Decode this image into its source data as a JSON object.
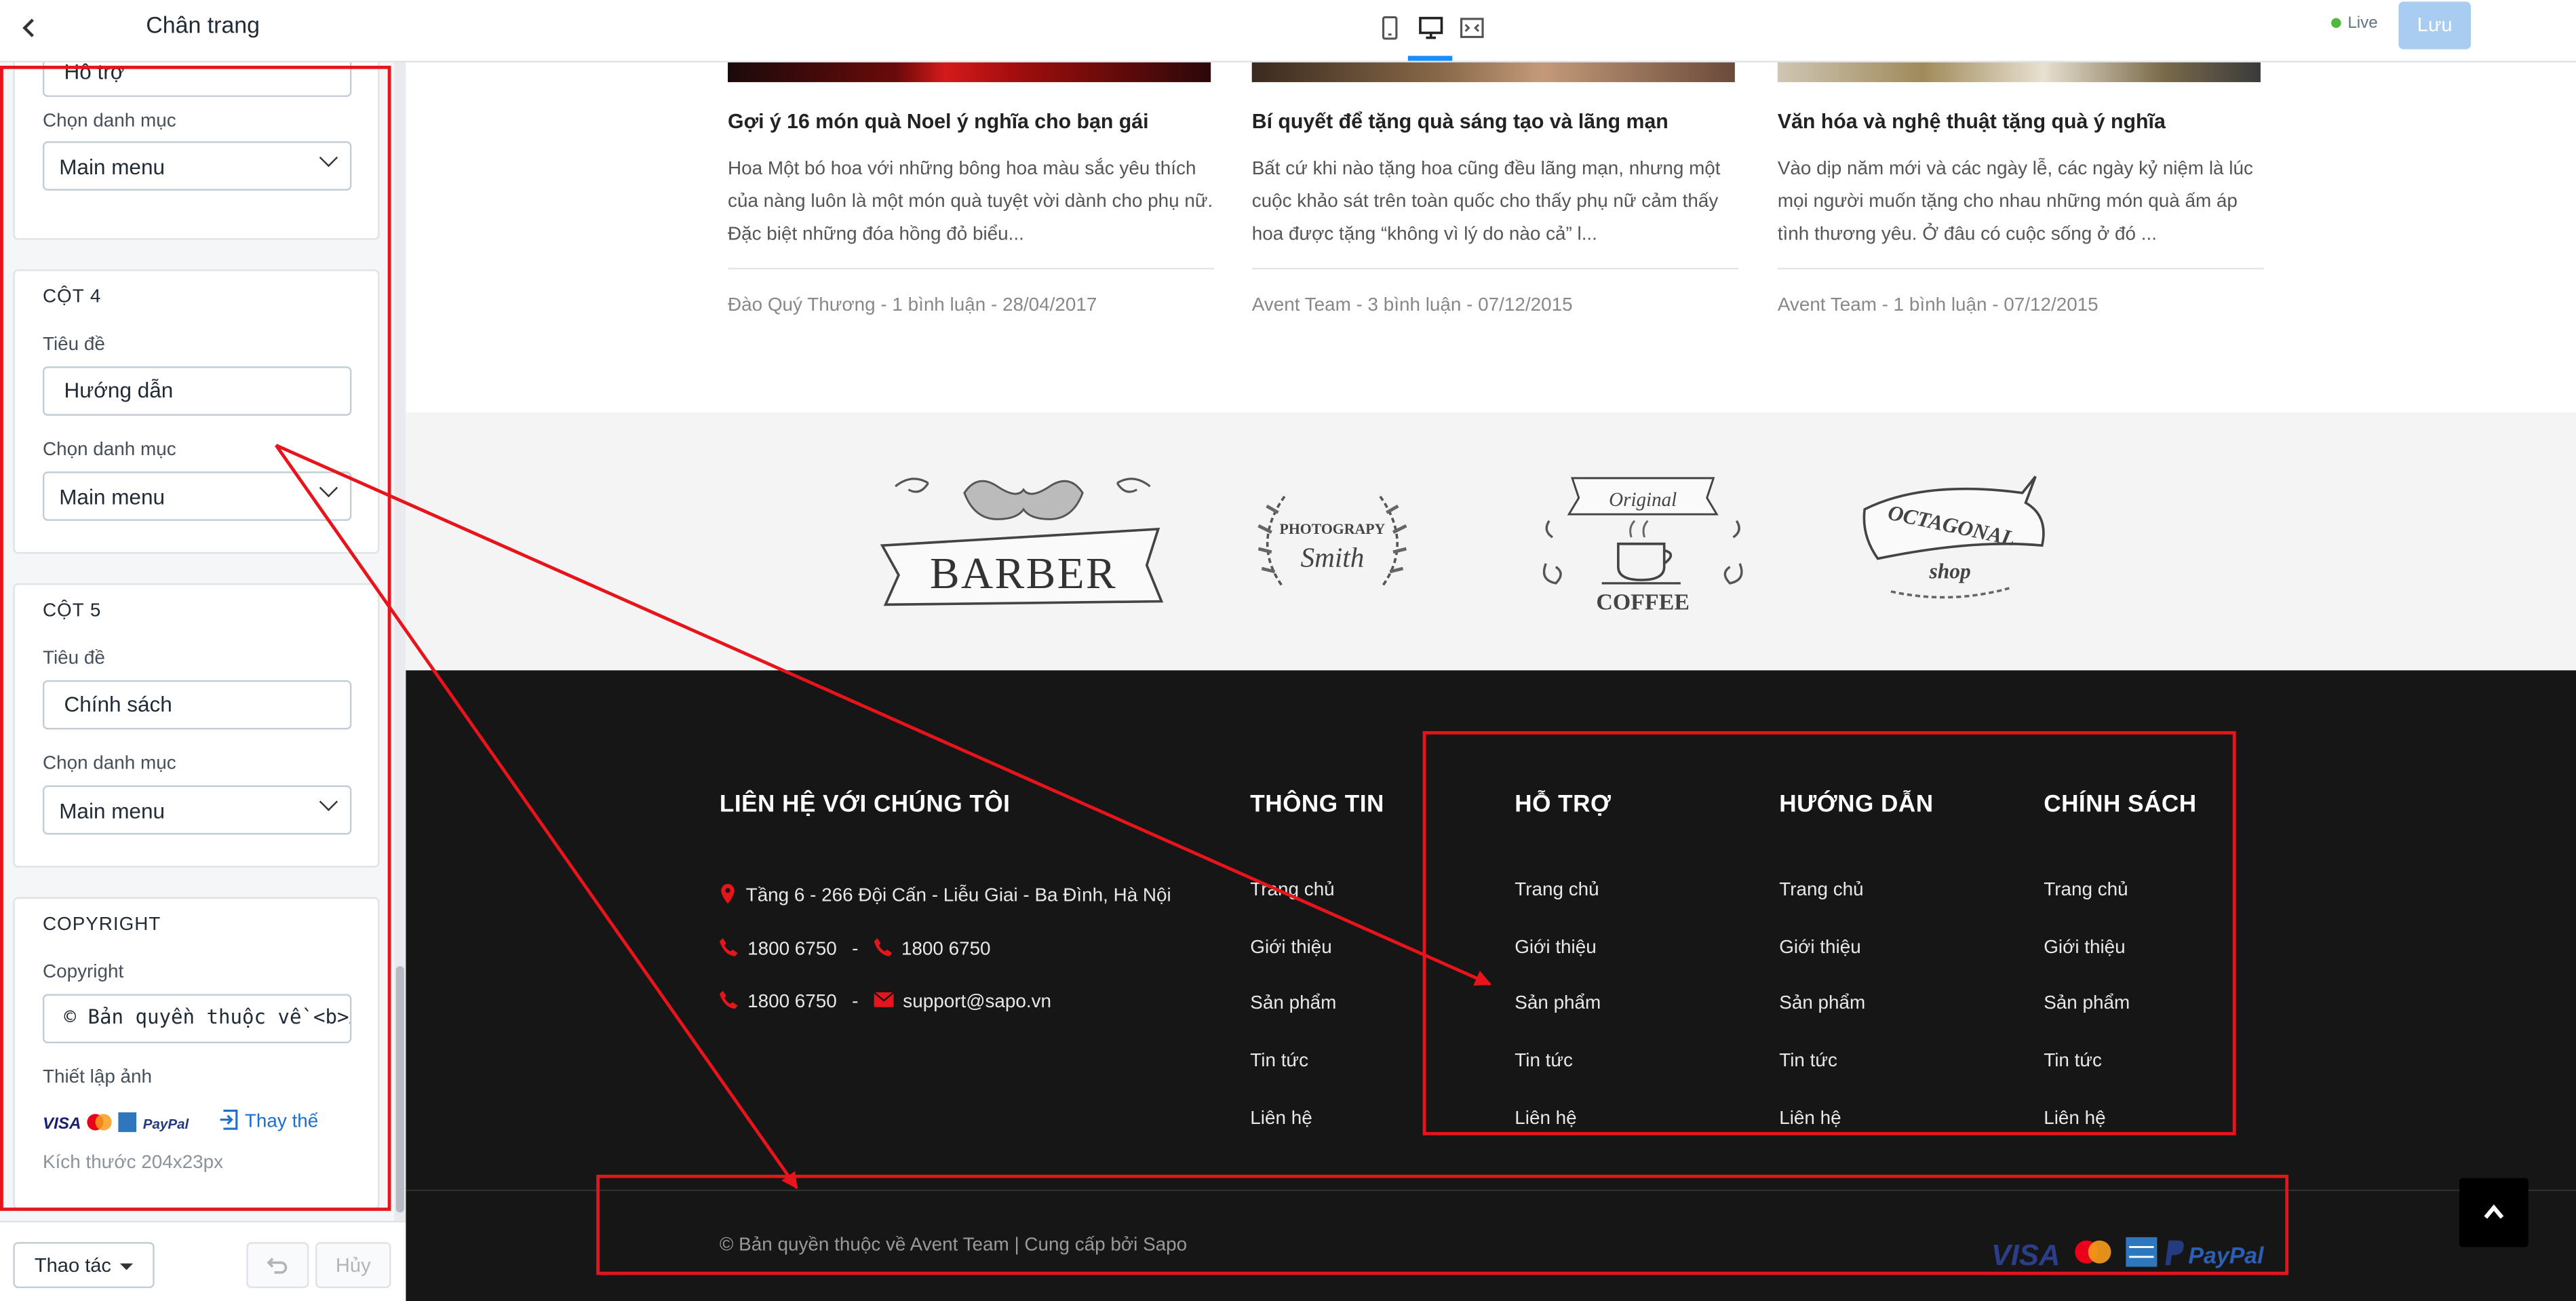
{
  "sidebar": {
    "title": "Chân trang",
    "col3": {
      "title_value": "Hỗ trợ",
      "menu_label": "Chọn danh mục",
      "menu_value": "Main menu"
    },
    "col4": {
      "heading": "CỘT 4",
      "title_label": "Tiêu đề",
      "title_value": "Hướng dẫn",
      "menu_label": "Chọn danh mục",
      "menu_value": "Main menu"
    },
    "col5": {
      "heading": "CỘT 5",
      "title_label": "Tiêu đề",
      "title_value": "Chính sách",
      "menu_label": "Chọn danh mục",
      "menu_value": "Main menu"
    },
    "copyright": {
      "heading": "COPYRIGHT",
      "label": "Copyright",
      "value": "© Bản quyền thuộc về <b>Avent Team</b>",
      "image_label": "Thiết lập ảnh",
      "replace_label": "Thay thế",
      "size_note": "Kích thước 204x23px"
    },
    "footer": {
      "actions_label": "Thao tác",
      "cancel_label": "Hủy"
    }
  },
  "topbar": {
    "live_label": "Live",
    "save_label": "Lưu"
  },
  "posts": [
    {
      "title": "Gợi ý 16 món quà Noel ý nghĩa cho bạn gái",
      "excerpt": "Hoa Một bó hoa với những bông hoa màu sắc yêu thích của nàng luôn là một món quà tuyệt vời dành cho phụ nữ. Đặc biệt những đóa hồng đỏ biểu...",
      "meta": "Đào Quý Thương - 1 bình luận - 28/04/2017"
    },
    {
      "title": "Bí quyết để tặng quà sáng tạo và lãng mạn",
      "excerpt": "Bất cứ khi nào tặng hoa cũng đều lãng mạn, nhưng một cuộc khảo sát trên toàn quốc cho thấy phụ nữ cảm thấy hoa được tặng “không vì lý do nào cả” l...",
      "meta": "Avent Team - 3 bình luận - 07/12/2015"
    },
    {
      "title": "Văn hóa và nghệ thuật tặng quà ý nghĩa",
      "excerpt": "Vào dịp năm mới và các ngày lễ, các ngày kỷ niệm là lúc mọi người muốn tặng cho nhau những món quà ấm áp tình thương yêu. Ở đâu có cuộc sống ở đó ...",
      "meta": "Avent Team - 1 bình luận - 07/12/2015"
    }
  ],
  "brands": {
    "barber": "BARBER",
    "photography_top": "PHOTOGRAPY",
    "photography_bottom": "Smith",
    "coffee_top": "Original",
    "coffee_bottom": "COFFEE",
    "octagonal_top": "OCTAGONAL",
    "octagonal_bottom": "shop"
  },
  "site_footer": {
    "contact": {
      "title": "LIÊN HỆ VỚI CHÚNG TÔI",
      "address": "Tầng 6 - 266 Đội Cấn - Liễu Giai - Ba Đình, Hà Nội",
      "phone1": "1800 6750",
      "phone2": "1800 6750",
      "phone3": "1800 6750",
      "email": "support@sapo.vn",
      "sep": "-"
    },
    "columns": [
      {
        "title": "THÔNG TIN",
        "links": [
          "Trang chủ",
          "Giới thiệu",
          "Sản phẩm",
          "Tin tức",
          "Liên hệ"
        ]
      },
      {
        "title": "HỖ TRỢ",
        "links": [
          "Trang chủ",
          "Giới thiệu",
          "Sản phẩm",
          "Tin tức",
          "Liên hệ"
        ]
      },
      {
        "title": "HƯỚNG DẪN",
        "links": [
          "Trang chủ",
          "Giới thiệu",
          "Sản phẩm",
          "Tin tức",
          "Liên hệ"
        ]
      },
      {
        "title": "CHÍNH SÁCH",
        "links": [
          "Trang chủ",
          "Giới thiệu",
          "Sản phẩm",
          "Tin tức",
          "Liên hệ"
        ]
      }
    ],
    "copyright": "© Bản quyền thuộc về Avent Team | Cung cấp bởi Sapo",
    "payments": {
      "visa": "VISA",
      "paypal": "PayPal"
    }
  },
  "colors": {
    "annotation": "#e8141c",
    "accent": "#1a8cff",
    "footer_bg": "#161616",
    "icon_red": "#e8141c"
  }
}
